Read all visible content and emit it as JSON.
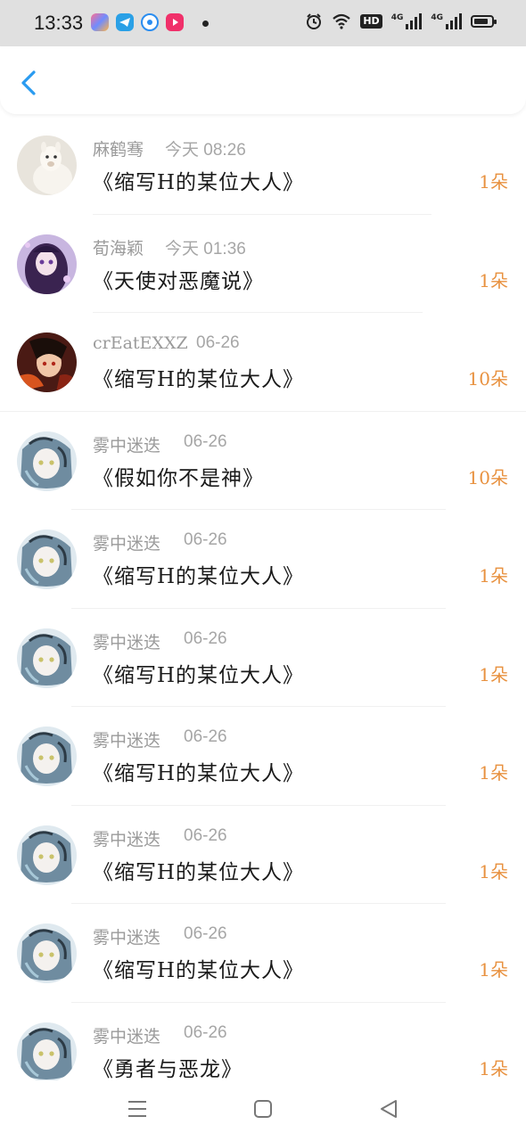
{
  "status_bar": {
    "time": "13:33",
    "network_badge": "HD",
    "signal_label_1": "4G",
    "signal_label_2": "4G"
  },
  "header": {
    "back_icon": "chevron-left-icon"
  },
  "items": [
    {
      "name": "麻鹤骞",
      "time": "今天 08:26",
      "title": "《缩写H的某位大人》",
      "count": "1朵"
    },
    {
      "name": "荀海颖",
      "time": "今天 01:36",
      "title": "《天使对恶魔说》",
      "count": "1朵"
    },
    {
      "name": "crEatEXXZ",
      "time": "06-26",
      "title": "《缩写H的某位大人》",
      "count": "10朵"
    },
    {
      "name": "雾中迷迭",
      "time": "06-26",
      "title": "《假如你不是神》",
      "count": "10朵"
    },
    {
      "name": "雾中迷迭",
      "time": "06-26",
      "title": "《缩写H的某位大人》",
      "count": "1朵"
    },
    {
      "name": "雾中迷迭",
      "time": "06-26",
      "title": "《缩写H的某位大人》",
      "count": "1朵"
    },
    {
      "name": "雾中迷迭",
      "time": "06-26",
      "title": "《缩写H的某位大人》",
      "count": "1朵"
    },
    {
      "name": "雾中迷迭",
      "time": "06-26",
      "title": "《缩写H的某位大人》",
      "count": "1朵"
    },
    {
      "name": "雾中迷迭",
      "time": "06-26",
      "title": "《缩写H的某位大人》",
      "count": "1朵"
    },
    {
      "name": "雾中迷迭",
      "time": "06-26",
      "title": "《勇者与恶龙》",
      "count": "1朵"
    }
  ],
  "colors": {
    "accent_blue": "#2a9bf0",
    "count_orange": "#e8913f",
    "status_bar_bg": "#e0e0e0"
  },
  "nav_bar": {
    "icons": [
      "menu-icon",
      "home-square-icon",
      "back-triangle-icon"
    ]
  }
}
